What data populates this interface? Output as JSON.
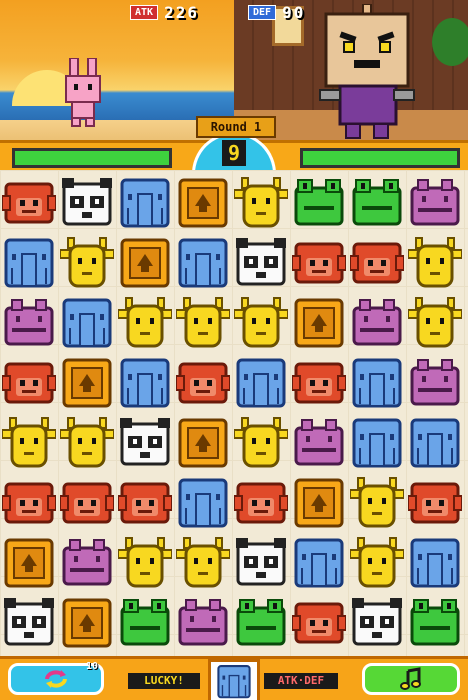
{
  "hud": {
    "atk_label": "ATK",
    "atk_value": "226",
    "def_label": "DEF",
    "def_value": "90",
    "round_label": "Round 1",
    "timer_value": "9",
    "player_hp": 1.0,
    "enemy_hp": 1.0
  },
  "colors": {
    "hp_fill": "#3ed33e",
    "hud_orange": "#f8a818",
    "timer_blue": "#33c3e8",
    "board_bg": "#f2ead6"
  },
  "characters": {
    "player": "pink-bunny",
    "enemy": "box-head-robot"
  },
  "board": {
    "columns": 8,
    "rows": 8,
    "grid": [
      [
        "monkey",
        "panda",
        "elephant",
        "lion",
        "giraffe",
        "frog",
        "frog",
        "hippo"
      ],
      [
        "elephant",
        "giraffe",
        "lion",
        "elephant",
        "panda",
        "monkey",
        "monkey",
        "giraffe"
      ],
      [
        "hippo",
        "elephant",
        "giraffe",
        "giraffe",
        "giraffe",
        "lion",
        "hippo",
        "giraffe"
      ],
      [
        "monkey",
        "lion",
        "elephant",
        "monkey",
        "elephant",
        "monkey",
        "elephant",
        "hippo"
      ],
      [
        "giraffe",
        "giraffe",
        "panda",
        "lion",
        "giraffe",
        "hippo",
        "elephant",
        "elephant"
      ],
      [
        "monkey",
        "monkey",
        "monkey",
        "elephant",
        "monkey",
        "lion",
        "giraffe",
        "monkey"
      ],
      [
        "lion",
        "hippo",
        "giraffe",
        "giraffe",
        "panda",
        "elephant",
        "giraffe",
        "elephant"
      ],
      [
        "panda",
        "lion",
        "frog",
        "hippo",
        "frog",
        "monkey",
        "panda",
        "frog"
      ]
    ]
  },
  "bottom_bar": {
    "reload_count": "10",
    "lucky_label": "LUCKY!",
    "lucky_animal": "elephant",
    "atkdef_label": "ATK·DEF",
    "reload_icon": "reload-icon",
    "sound_icon": "music-note-icon"
  }
}
